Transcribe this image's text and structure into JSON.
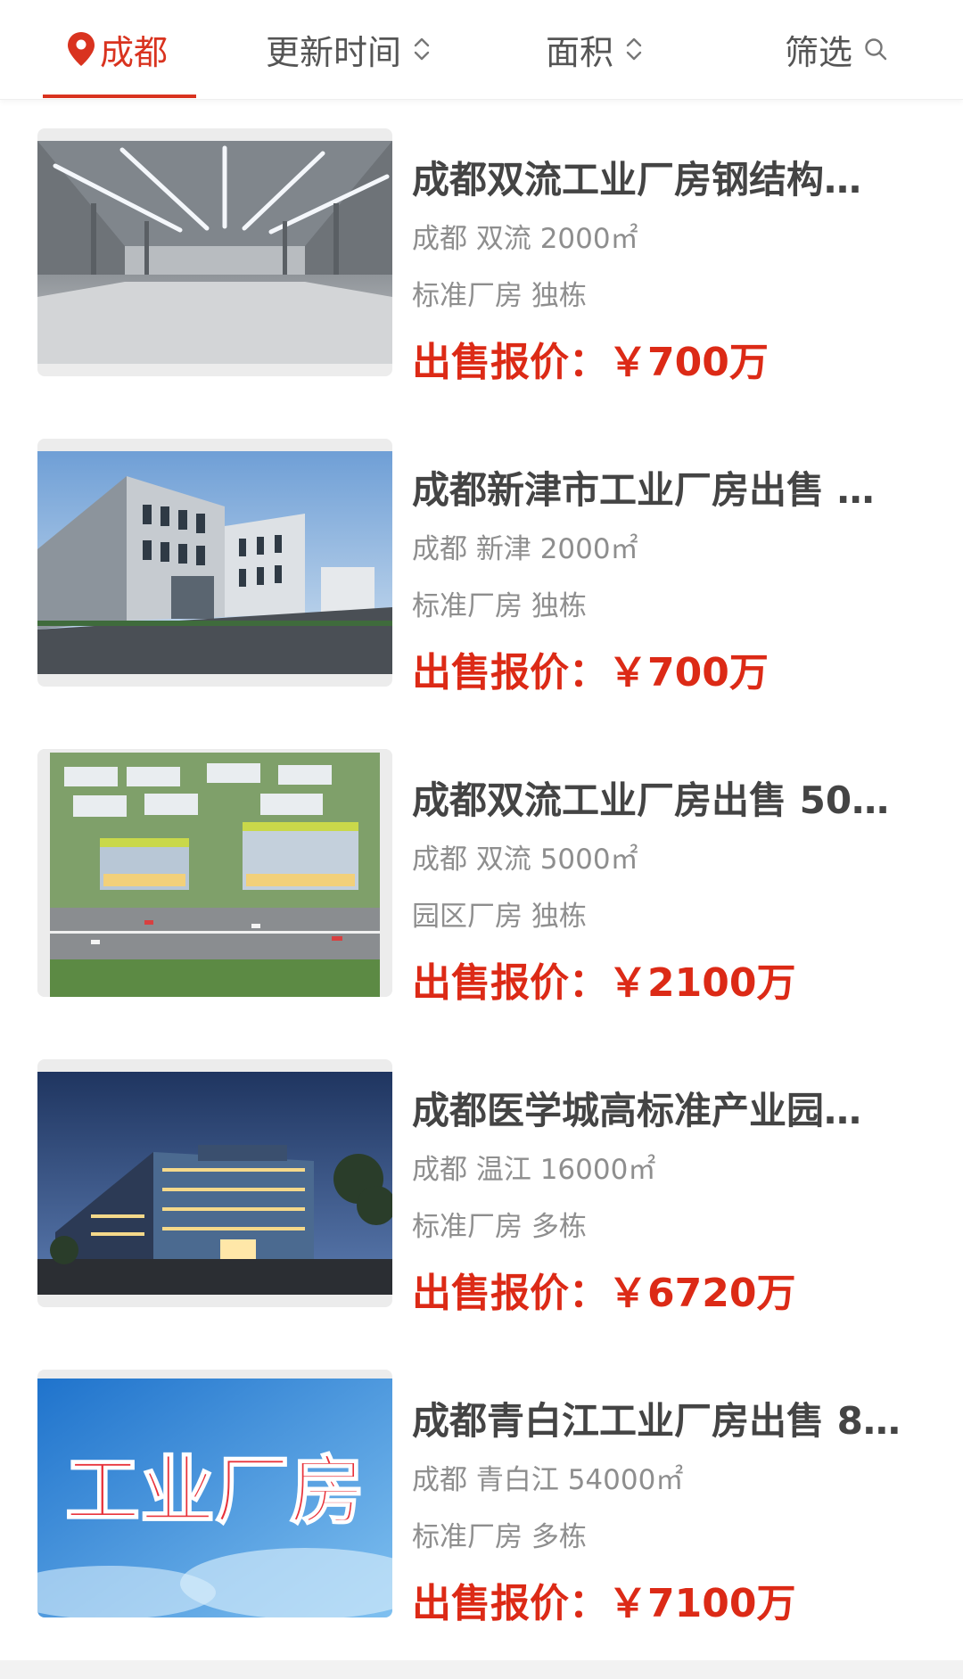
{
  "filter_bar": {
    "city": "成都",
    "sort_time": "更新时间",
    "sort_area": "面积",
    "filter": "筛选",
    "accent": "#d9331f"
  },
  "listings": [
    {
      "title": "成都双流工业厂房钢结构…",
      "location": "成都 双流 2000㎡",
      "tags": "标准厂房 独栋",
      "price": "出售报价：￥700万",
      "image": "warehouse-interior"
    },
    {
      "title": "成都新津市工业厂房出售 …",
      "location": "成都 新津 2000㎡",
      "tags": "标准厂房 独栋",
      "price": "出售报价：￥700万",
      "image": "factory-exterior"
    },
    {
      "title": "成都双流工业厂房出售 50…",
      "location": "成都 双流 5000㎡",
      "tags": "园区厂房 独栋",
      "price": "出售报价：￥2100万",
      "image": "industrial-park-model"
    },
    {
      "title": "成都医学城高标准产业园…",
      "location": "成都 温江 16000㎡",
      "tags": "标准厂房 多栋",
      "price": "出售报价：￥6720万",
      "image": "office-building-night"
    },
    {
      "title": "成都青白江工业厂房出售 8…",
      "location": "成都 青白江 54000㎡",
      "tags": "标准厂房 多栋",
      "price": "出售报价：￥7100万",
      "image": "banner-graphic",
      "image_text": "工业厂房"
    }
  ]
}
